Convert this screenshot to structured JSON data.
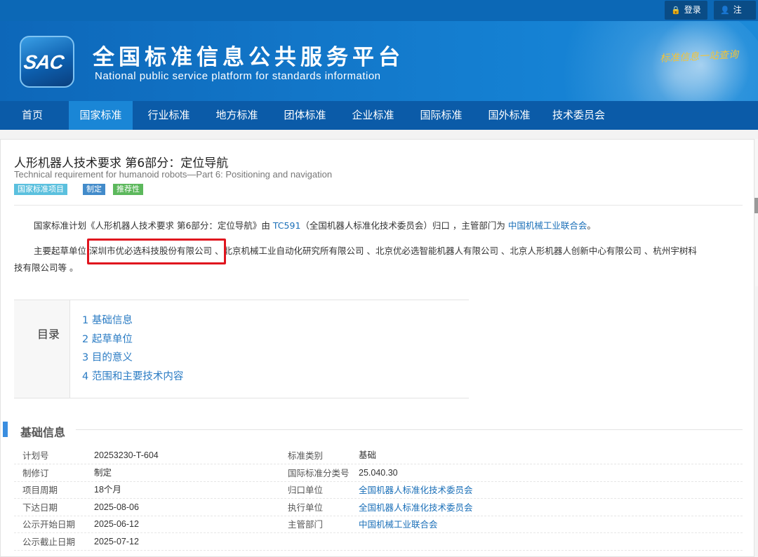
{
  "topbar": {
    "login_label": "登录",
    "register_label": "注册"
  },
  "banner": {
    "logo_text": "SAC",
    "title_zh": "全国标准信息公共服务平台",
    "title_en": "National public service platform  for standards information",
    "slogan": "标准信息一站查询"
  },
  "nav": [
    "首页",
    "国家标准",
    "行业标准",
    "地方标准",
    "团体标准",
    "企业标准",
    "国际标准",
    "国外标准",
    "技术委员会"
  ],
  "project": {
    "title": "人形机器人技术要求 第6部分：定位导航",
    "title_en": "Technical requirement for humanoid robots—Part 6: Positioning and navigation",
    "badges": [
      "国家标准项目",
      "制定",
      "推荐性"
    ]
  },
  "intro": {
    "p1_a": "国家标准计划《人形机器人技术要求 第6部分：定位导航》由 ",
    "p1_tc": "TC591",
    "p1_b": "（全国机器人标准化技术委员会）归口 ，主管部门为 ",
    "p1_dept": "中国机械工业联合会",
    "p1_c": "。",
    "p2_a": "主要起草单位 ",
    "p2_highlight": "深圳市优必选科技股份有限公司",
    "p2_b": " 、北京机械工业自动化研究所有限公司 、北京优必选智能机器人有限公司 、北京人形机器人创新中心有限公司 、杭州宇树科",
    "p2_c": "技有限公司等 。"
  },
  "toc": {
    "title": "目录",
    "items": [
      "1  基础信息",
      "2  起草单位",
      "3  目的意义",
      "4  范围和主要技术内容"
    ]
  },
  "section": {
    "title": "基础信息",
    "left": [
      {
        "k": "计划号",
        "v": "20253230-T-604"
      },
      {
        "k": "制修订",
        "v": "制定"
      },
      {
        "k": "项目周期",
        "v": "18个月"
      },
      {
        "k": "下达日期",
        "v": "2025-08-06"
      },
      {
        "k": "公示开始日期",
        "v": "2025-06-12"
      },
      {
        "k": "公示截止日期",
        "v": "2025-07-12"
      }
    ],
    "right": [
      {
        "k": "标准类别",
        "v": "基础"
      },
      {
        "k": "国际标准分类号",
        "v": "25.040.30"
      },
      {
        "k": "归口单位",
        "v": "全国机器人标准化技术委员会"
      },
      {
        "k": "执行单位",
        "v": "全国机器人标准化技术委员会"
      },
      {
        "k": "主管部门",
        "v": "中国机械工业联合会"
      }
    ]
  },
  "colors": {
    "primary": "#0b5ba8",
    "active": "#1a86d6",
    "link": "#1a6fb8",
    "highlight": "#e0141e"
  }
}
